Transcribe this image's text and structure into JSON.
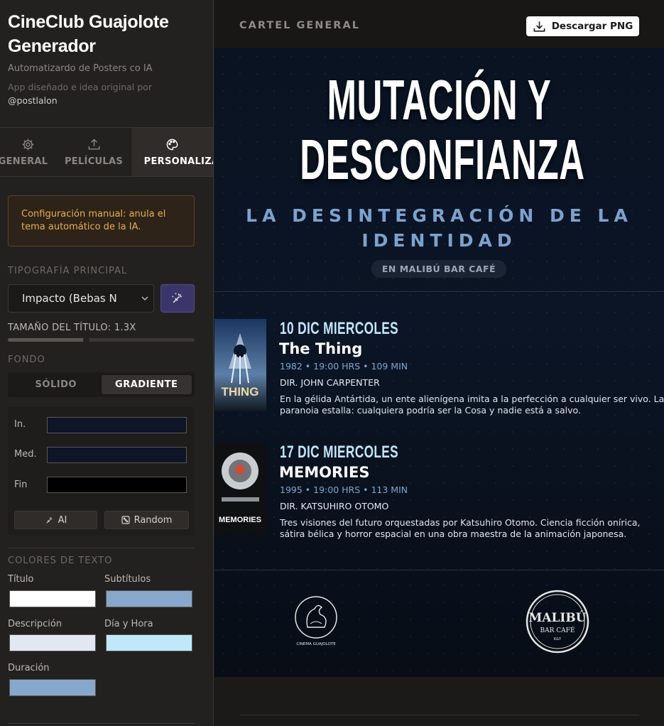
{
  "sidebar": {
    "title_line1": "CineClub Guajolote",
    "title_line2": "Generador",
    "tagline": "Automatizardo de Posters co IA",
    "credit_line1": "App diseñado e idea original por",
    "credit_handle": "@postlalon",
    "tabs": [
      {
        "label": "GENERAL",
        "icon": "gear-icon"
      },
      {
        "label": "PELÍCULAS",
        "icon": "upload-icon"
      },
      {
        "label": "PERSONALIZA",
        "icon": "palette-icon",
        "active": true
      }
    ],
    "notice": "Configuración manual: anula el tema automático de la IA.",
    "typography_label": "TIPOGRAFÍA PRINCIPAL",
    "font_select_value": "Impacto (Bebas N",
    "title_size_label": "TAMAÑO DEL TÍTULO: 1.3X",
    "title_size_fraction": 0.42,
    "background_label": "FONDO",
    "bg_modes": [
      "SÓLIDO",
      "GRADIENTE"
    ],
    "bg_mode_selected": "GRADIENTE",
    "gradient": {
      "start_label": "In.",
      "mid_label": "Med.",
      "end_label": "Fin",
      "start_color": "#0d1527",
      "mid_color": "#0d1527",
      "end_color": "#000000",
      "ai_label": "AI",
      "random_label": "Random"
    },
    "text_colors_label": "COLORES DE TEXTO",
    "text_colors": {
      "title_label": "Título",
      "title_color": "#ffffff",
      "subtitle_label": "Subtítulos",
      "subtitle_color": "#86a8cd",
      "description_label": "Descripción",
      "description_color": "#e2e8f2",
      "datetime_label": "Día y Hora",
      "datetime_color": "#bfe9fb",
      "duration_label": "Duración",
      "duration_color": "#86a8cd"
    }
  },
  "main": {
    "section_title": "CARTEL GENERAL",
    "download_label": "Descargar PNG",
    "poster": {
      "title_line1": "MUTACIÓN Y",
      "title_line2": "DESCONFIANZA",
      "subtitle_line1": "LA DESINTEGRACIÓN DE LA",
      "subtitle_line2": "IDENTIDAD",
      "venue": "EN MALIBÚ BAR CAFÉ",
      "films": [
        {
          "date": "10 DIC MIERCOLES",
          "title": "The Thing",
          "meta": "1982 • 19:00 HRS • 109 MIN",
          "director": "DIR. JOHN CARPENTER",
          "description": "En la gélida Antártida, un ente alienígena imita a la perfección a cualquier ser vivo. La paranoia estalla: cualquiera podría ser la Cosa y nadie está a salvo.",
          "poster_text": "THING"
        },
        {
          "date": "17 DIC MIERCOLES",
          "title": "MEMORIES",
          "meta": "1995 • 19:00 HRS • 113 MIN",
          "director": "DIR. KATSUHIRO OTOMO",
          "description": "Tres visiones del futuro orquestadas por Katsuhiro Otomo. Ciencia ficción onírica, sátira bélica y horror espacial en una obra maestra de la animación japonesa.",
          "poster_text": "MEMORIES"
        }
      ],
      "logo_cine_text": "CINEMA GUAJOLOTE",
      "logo_malibu_line1": "MALIBÚ",
      "logo_malibu_line2": "BAR CAFÉ",
      "logo_malibu_line3": "K&Y"
    }
  }
}
